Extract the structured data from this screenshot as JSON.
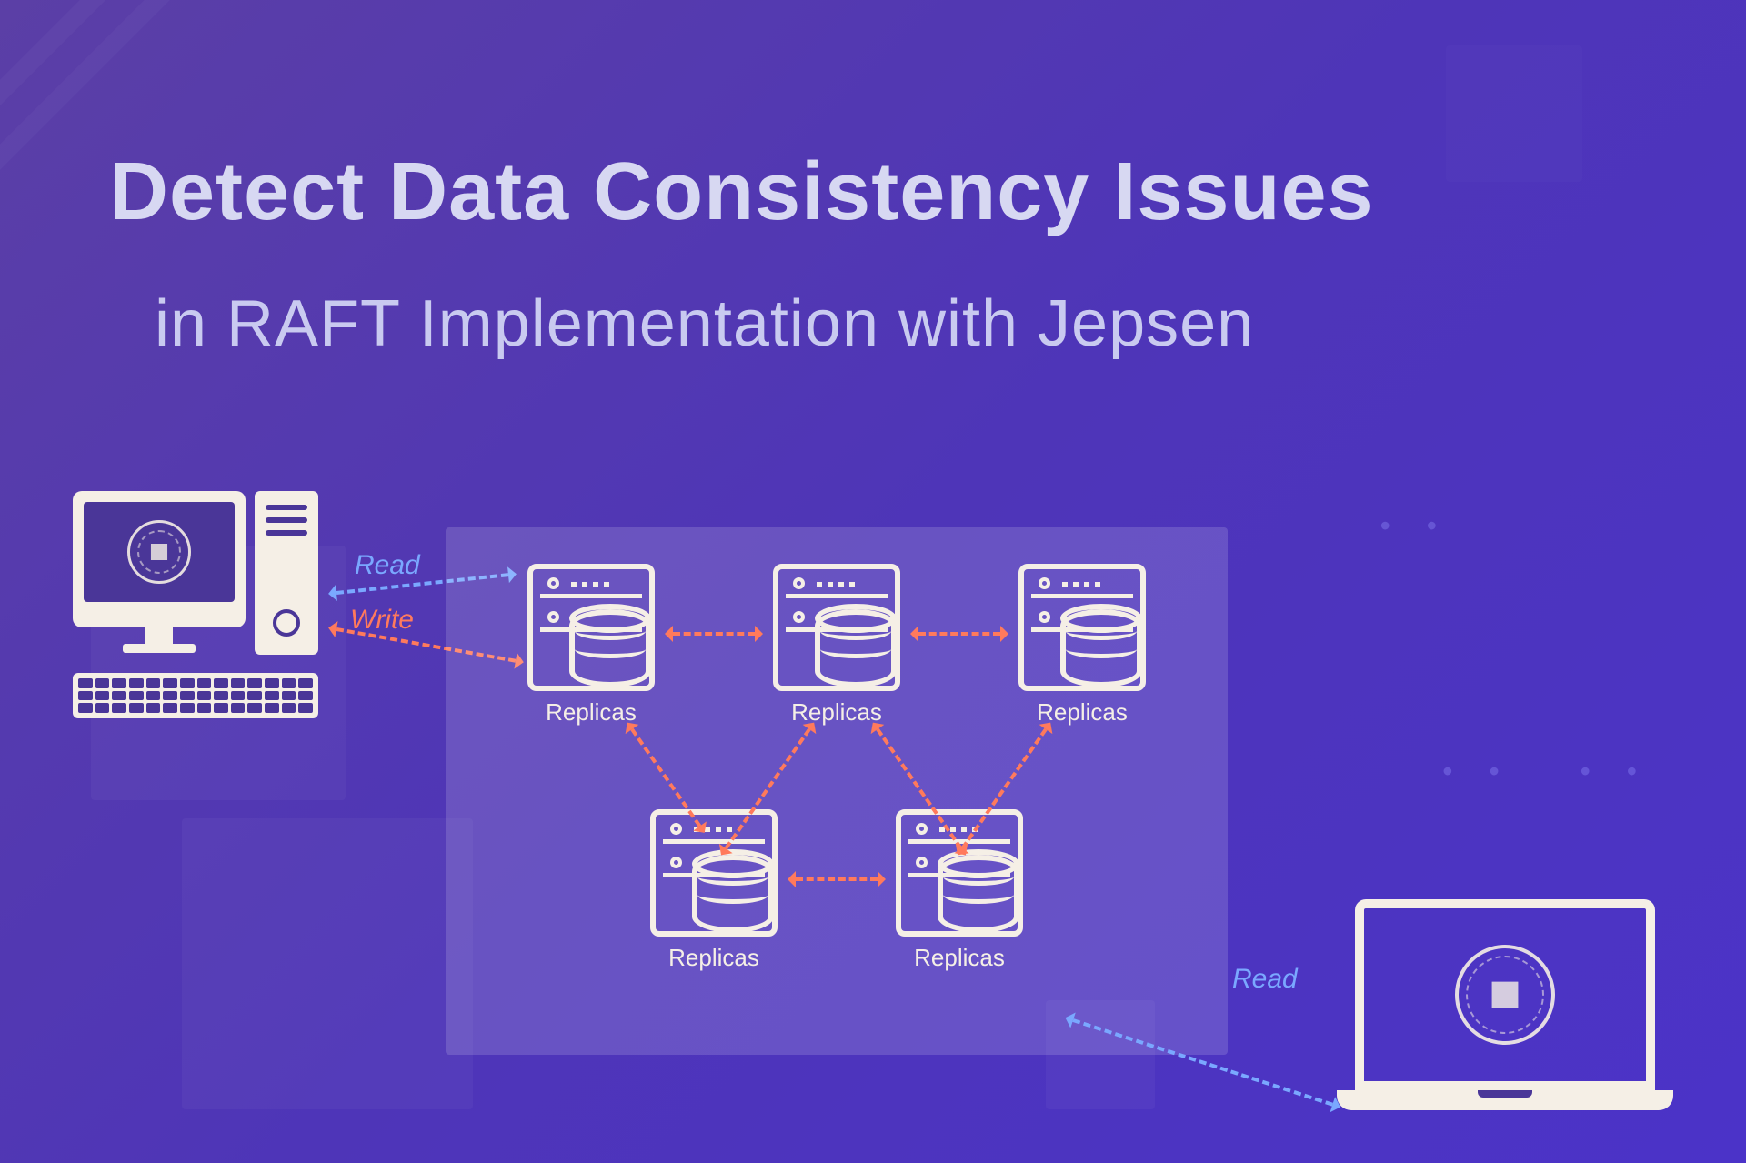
{
  "title": {
    "main": "Detect Data Consistency Issues",
    "sub": "in RAFT Implementation with Jepsen"
  },
  "cluster": {
    "replica_label": "Replicas"
  },
  "connections": {
    "read": "Read",
    "write": "Write"
  },
  "icons": {
    "desktop": "client-desktop",
    "laptop": "client-laptop",
    "nebula_logo": "nebula-logo",
    "replica": "database-replica"
  },
  "colors": {
    "bg_from": "#5b3fa6",
    "bg_to": "#4b33c8",
    "text_light": "#d7d8f2",
    "cream": "#f5efe6",
    "arrow_orange": "#ff7a5c",
    "arrow_blue": "#7aa8ff"
  }
}
